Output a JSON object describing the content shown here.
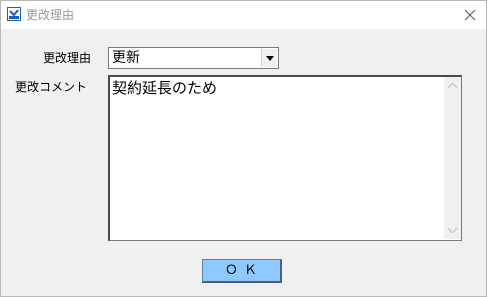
{
  "window": {
    "title": "更改理由"
  },
  "form": {
    "reason_label": "更改理由",
    "reason_value": "更新",
    "comment_label": "更改コメント",
    "comment_value": "契約延長のため"
  },
  "buttons": {
    "ok_label": "Ｏ Ｋ"
  },
  "colors": {
    "ok_button_bg": "#8fc8ff",
    "title_text": "#9a9a9a",
    "window_bg": "#f0f0f0"
  }
}
